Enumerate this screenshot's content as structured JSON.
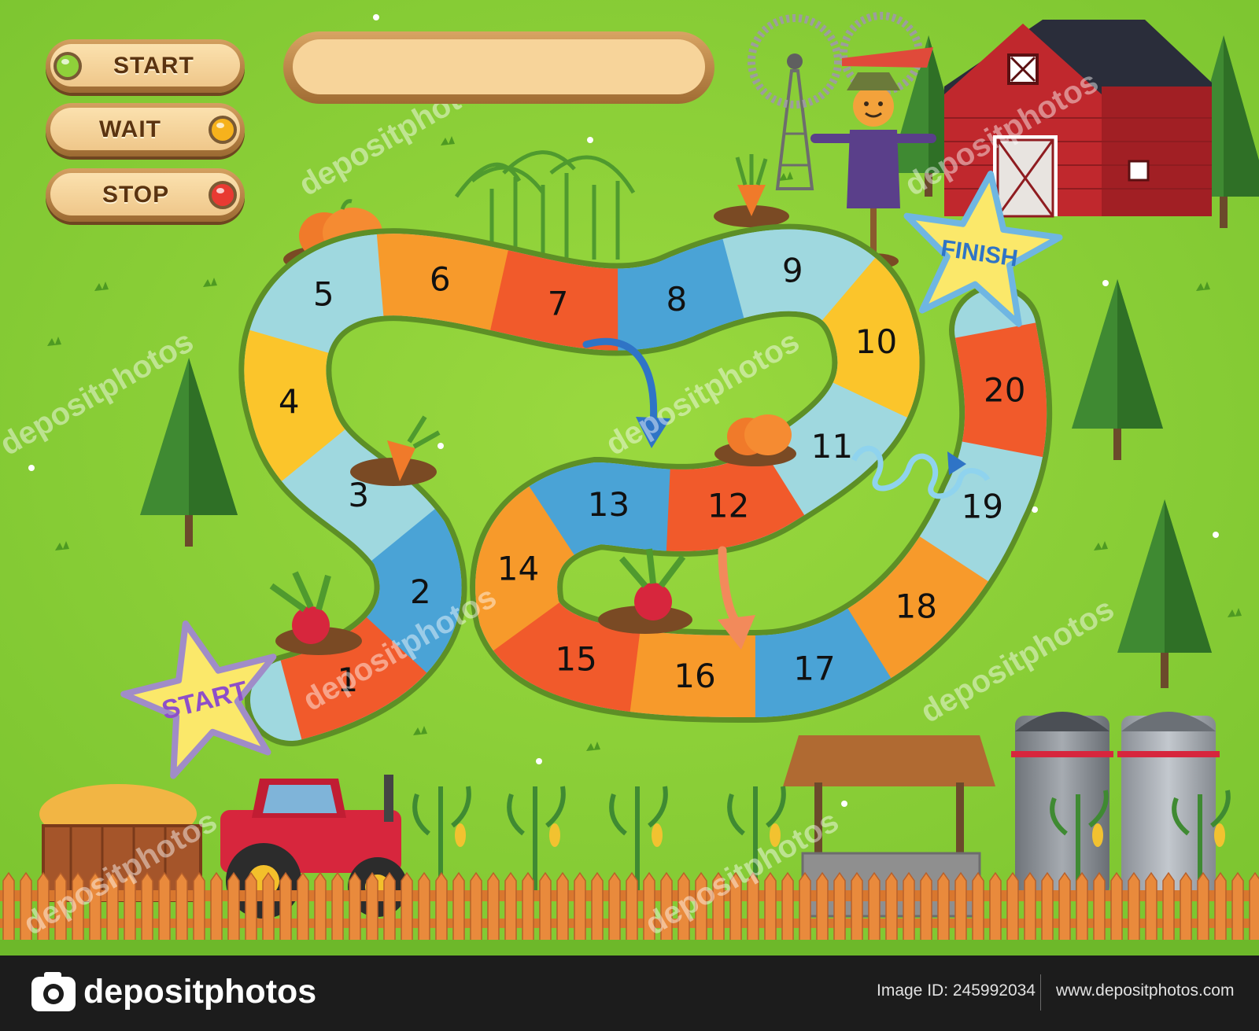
{
  "controls": [
    {
      "label": "START",
      "led_color": "#8fd13a",
      "led_side": "left"
    },
    {
      "label": "WAIT",
      "led_color": "#f6b21c",
      "led_side": "right"
    },
    {
      "label": "STOP",
      "led_color": "#e83a32",
      "led_side": "right"
    }
  ],
  "message_bar": {
    "text": ""
  },
  "board": {
    "start_label": "START",
    "finish_label": "FINISH",
    "tiles": [
      "1",
      "2",
      "3",
      "4",
      "5",
      "6",
      "7",
      "8",
      "9",
      "10",
      "11",
      "12",
      "13",
      "14",
      "15",
      "16",
      "17",
      "18",
      "19",
      "20"
    ],
    "tile_colors": [
      "#f15a2b",
      "#4aa3d6",
      "#9fd8df",
      "#fbc52b",
      "#9fd8df",
      "#f79a2b",
      "#f15a2b",
      "#4aa3d6",
      "#9fd8df",
      "#fbc52b",
      "#9fd8df",
      "#f15a2b",
      "#4aa3d6",
      "#f79a2b",
      "#f15a2b",
      "#f79a2b",
      "#4aa3d6",
      "#f79a2b",
      "#9fd8df",
      "#f15a2b"
    ],
    "shortcuts": [
      {
        "from": "7",
        "to": "12",
        "kind": "arrow",
        "color": "#2f74c6"
      },
      {
        "from": "11",
        "to": "16",
        "kind": "arrow",
        "color": "#f28a5b"
      },
      {
        "from": "10",
        "to": "19",
        "kind": "spring",
        "color": "#8fd3ee"
      }
    ]
  },
  "colors": {
    "grass": "#8fd13a",
    "grass_dark": "#6db82a",
    "barn": "#c0282d",
    "path_edge": "#5d8f26"
  },
  "watermark": "depositphotos",
  "footer": {
    "logo": "depositphotos",
    "image_id": "Image ID: 245992034",
    "website": "www.depositphotos.com"
  }
}
